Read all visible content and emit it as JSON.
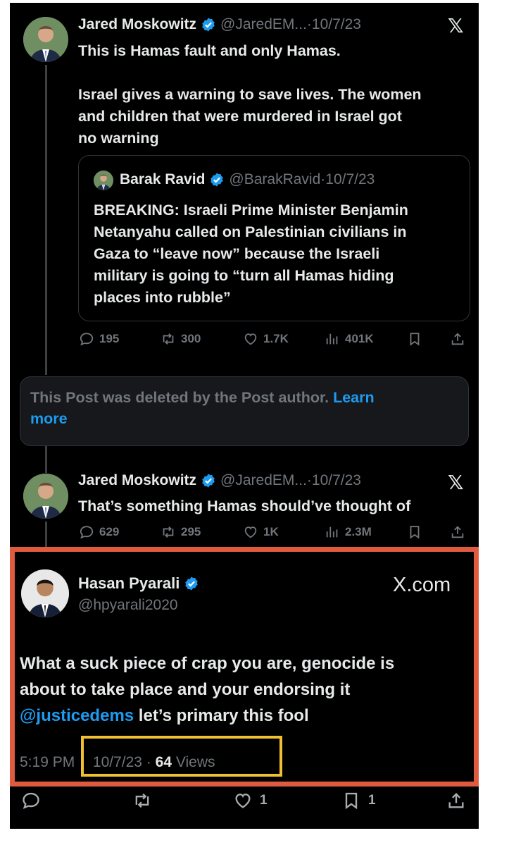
{
  "tweet1": {
    "name": "Jared Moskowitz",
    "handle": "@JaredEM...",
    "dot": " · ",
    "date": "10/7/23",
    "lines": [
      "This is Hamas fault and only Hamas.",
      "",
      "Israel gives a warning to save lives. The women",
      "and children that were murdered in Israel got",
      "no warning"
    ],
    "quote": {
      "name": "Barak Ravid",
      "handle": "@BarakRavid",
      "dot": " · ",
      "date": "10/7/23",
      "lines": [
        "BREAKING: Israeli Prime Minister Benjamin",
        "Netanyahu called on Palestinian civilians in",
        "Gaza to “leave now” because the Israeli",
        "military is going to “turn all Hamas hiding",
        "places into rubble”"
      ]
    },
    "stats": {
      "replies": "195",
      "reposts": "300",
      "likes": "1.7K",
      "views": "401K"
    }
  },
  "deleted": {
    "text": "This Post was deleted by the Post author. ",
    "link1": "Learn",
    "link2": "more"
  },
  "tweet2": {
    "name": "Jared Moskowitz",
    "handle": "@JaredEM...",
    "dot": " · ",
    "date": "10/7/23",
    "text": "That’s something Hamas should’ve thought of",
    "stats": {
      "replies": "629",
      "reposts": "295",
      "likes": "1K",
      "views": "2.3M"
    }
  },
  "tweet3": {
    "name": "Hasan Pyarali",
    "handle": "@hpyarali2020",
    "brand": "X.com",
    "line1": "What a suck piece of crap you are, genocide is",
    "line2": "about to take place and your endorsing it",
    "mention": "@justicedems",
    "line3_rest": " let’s primary this fool",
    "time": "5:19 PM",
    "date": "10/7/23",
    "dot": " · ",
    "views_count": "64",
    "views_label": " Views",
    "likes": "1",
    "bookmarks": "1"
  },
  "colors": {
    "accent": "#1d9bf0",
    "red_frame": "#e05a3f",
    "yellow_frame": "#f0c030",
    "background": "#000000"
  },
  "icons": [
    "x-logo-icon",
    "verified-badge-icon",
    "reply-icon",
    "repost-icon",
    "like-icon",
    "views-icon",
    "bookmark-icon",
    "share-icon"
  ]
}
